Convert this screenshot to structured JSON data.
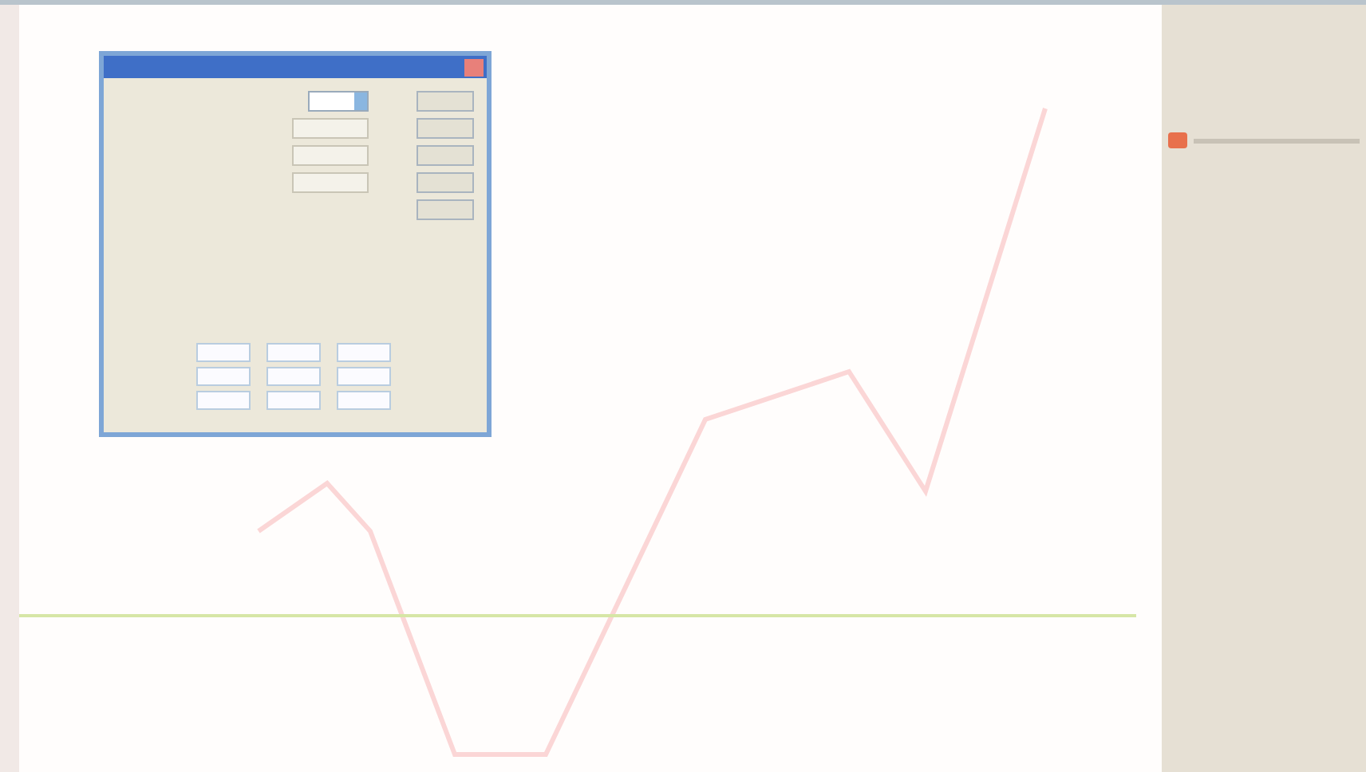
{
  "dialog": {
    "top_fields": [
      {
        "kind": "dropdown"
      },
      {
        "kind": "field"
      },
      {
        "kind": "field"
      },
      {
        "kind": "field"
      }
    ],
    "buttons": [
      {
        "kind": "button"
      },
      {
        "kind": "button"
      },
      {
        "kind": "button"
      },
      {
        "kind": "button"
      },
      {
        "kind": "button"
      }
    ],
    "table_rows": [
      {
        "kind": "row"
      },
      {
        "kind": "row"
      },
      {
        "kind": "row"
      }
    ]
  },
  "legend": [
    {
      "color": "#e8704c"
    }
  ]
}
